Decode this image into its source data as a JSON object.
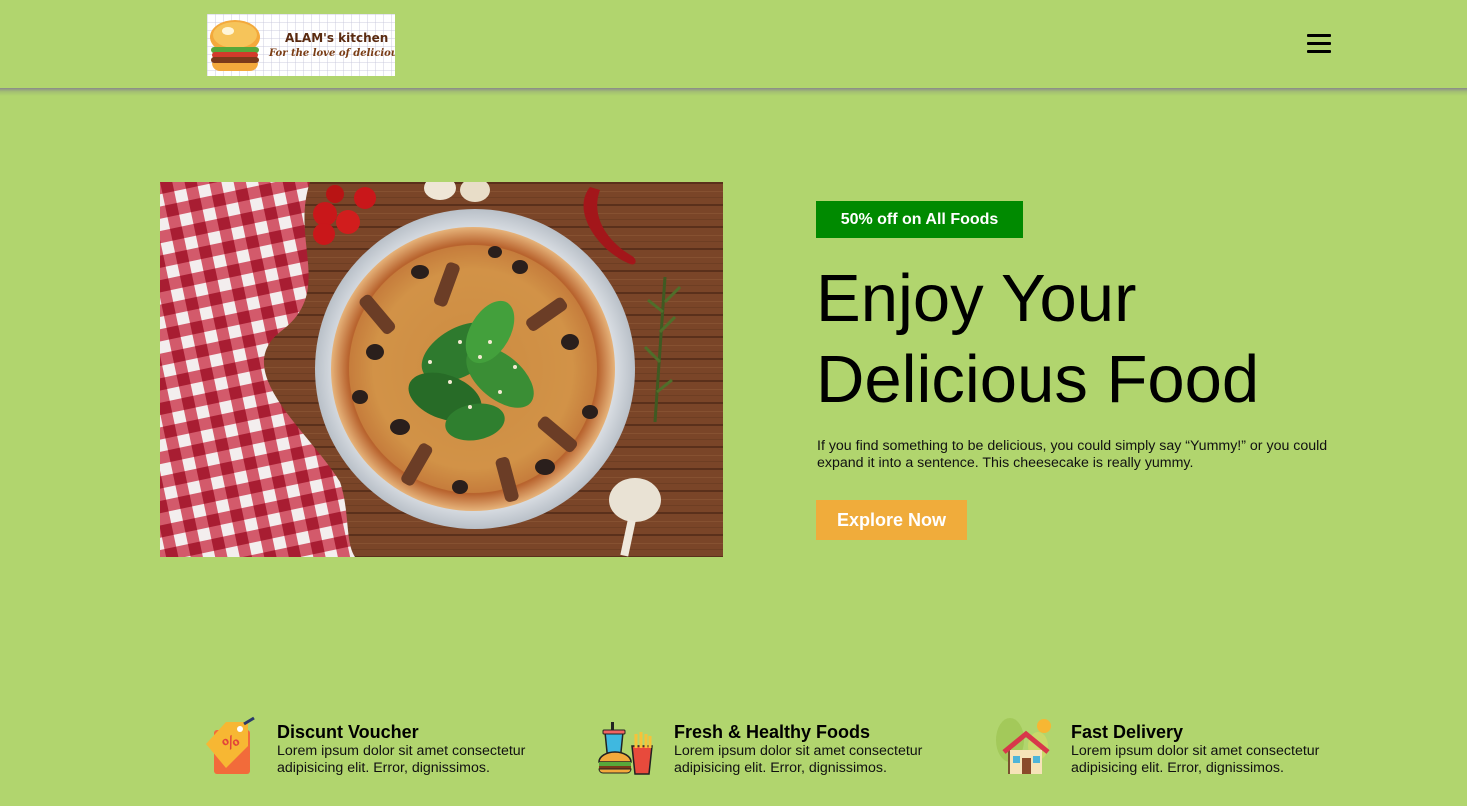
{
  "header": {
    "logo": {
      "title": "ALAM's kitchen",
      "tagline": "For the love of delicious food"
    },
    "menu_icon": "hamburger-menu-icon"
  },
  "hero": {
    "badge": "50% off on All Foods",
    "title_line1": "Enjoy Your",
    "title_line2": "Delicious Food",
    "description": "If you find something to be delicious, you could simply say “Yummy!” or you could expand it into a sentence. This cheesecake is really yummy.",
    "cta_label": "Explore Now"
  },
  "features": [
    {
      "icon": "discount-tag-icon",
      "title": "Discunt Voucher",
      "text": "Lorem ipsum dolor sit amet consectetur adipisicing elit. Error, dignissimos."
    },
    {
      "icon": "fast-food-icon",
      "title": "Fresh & Healthy Foods",
      "text": "Lorem ipsum dolor sit amet consectetur adipisicing elit. Error, dignissimos."
    },
    {
      "icon": "house-delivery-icon",
      "title": "Fast Delivery",
      "text": "Lorem ipsum dolor sit amet consectetur adipisicing elit. Error, dignissimos."
    }
  ],
  "colors": {
    "background": "#b1d56e",
    "badge": "#008a00",
    "cta": "#f0ac3b"
  }
}
